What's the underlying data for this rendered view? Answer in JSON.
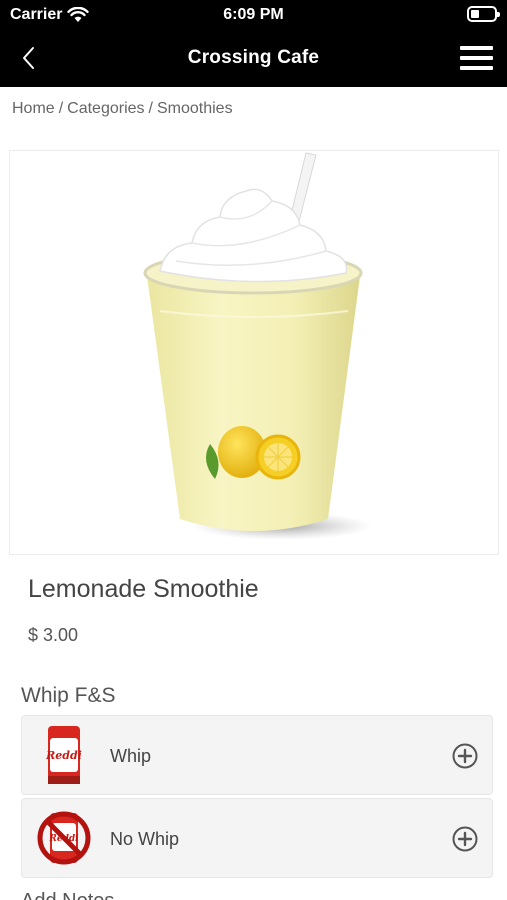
{
  "status": {
    "carrier": "Carrier",
    "time": "6:09 PM"
  },
  "nav": {
    "title": "Crossing Cafe"
  },
  "breadcrumb": [
    "Home",
    "/",
    "Categories",
    "/",
    "Smoothies"
  ],
  "product": {
    "name": "Lemonade Smoothie",
    "price": "$ 3.00"
  },
  "whip_section": {
    "title": "Whip F&S",
    "options": [
      {
        "label": "Whip"
      },
      {
        "label": "No Whip"
      }
    ]
  },
  "next_section": {
    "title": "Add Notes"
  },
  "colors": {
    "nav_bg": "#000000",
    "option_bg": "#f4f4f4",
    "smoothie_yellow": "#f5f1b0",
    "lemon": "#f2c418"
  }
}
